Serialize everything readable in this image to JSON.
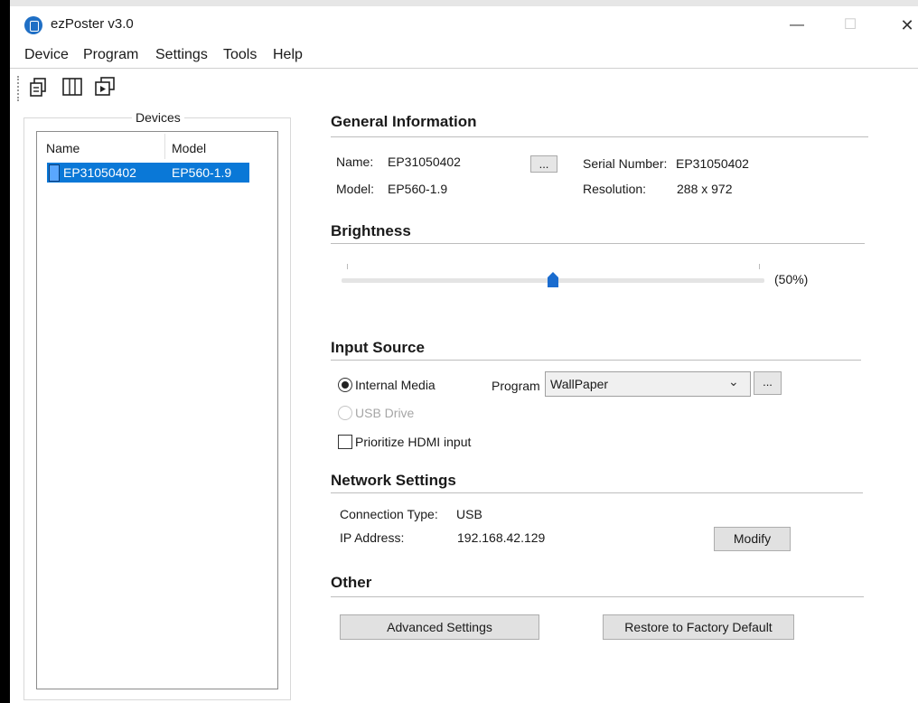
{
  "window": {
    "title": "ezPoster v3.0",
    "minimize": "—",
    "maximize": "☐",
    "close": "✕"
  },
  "menu": [
    "Device",
    "Program",
    "Settings",
    "Tools",
    "Help"
  ],
  "devices": {
    "label": "Devices",
    "columns": [
      "Name",
      "Model"
    ],
    "rows": [
      {
        "name": "EP31050402",
        "model": "EP560-1.9"
      }
    ]
  },
  "general": {
    "heading": "General Information",
    "name_label": "Name:",
    "name_value": "EP31050402",
    "ellipsis": "...",
    "serial_label": "Serial Number:",
    "serial_value": "EP31050402",
    "model_label": "Model:",
    "model_value": "EP560-1.9",
    "resolution_label": "Resolution:",
    "resolution_value": "288 x 972"
  },
  "brightness": {
    "heading": "Brightness",
    "value": 50,
    "display": "(50%)"
  },
  "input": {
    "heading": "Input Source",
    "internal": "Internal Media",
    "usb": "USB Drive",
    "hdmi": "Prioritize HDMI input",
    "program_label": "Program",
    "program_value": "WallPaper",
    "ellipsis": "..."
  },
  "network": {
    "heading": "Network Settings",
    "conn_label": "Connection Type:",
    "conn_value": "USB",
    "ip_label": "IP Address:",
    "ip_value": "192.168.42.129",
    "modify": "Modify"
  },
  "other": {
    "heading": "Other",
    "advanced": "Advanced Settings",
    "restore": "Restore to Factory Default"
  },
  "colors": {
    "selection": "#0a78d7",
    "slider_thumb": "#1a6ccf"
  }
}
